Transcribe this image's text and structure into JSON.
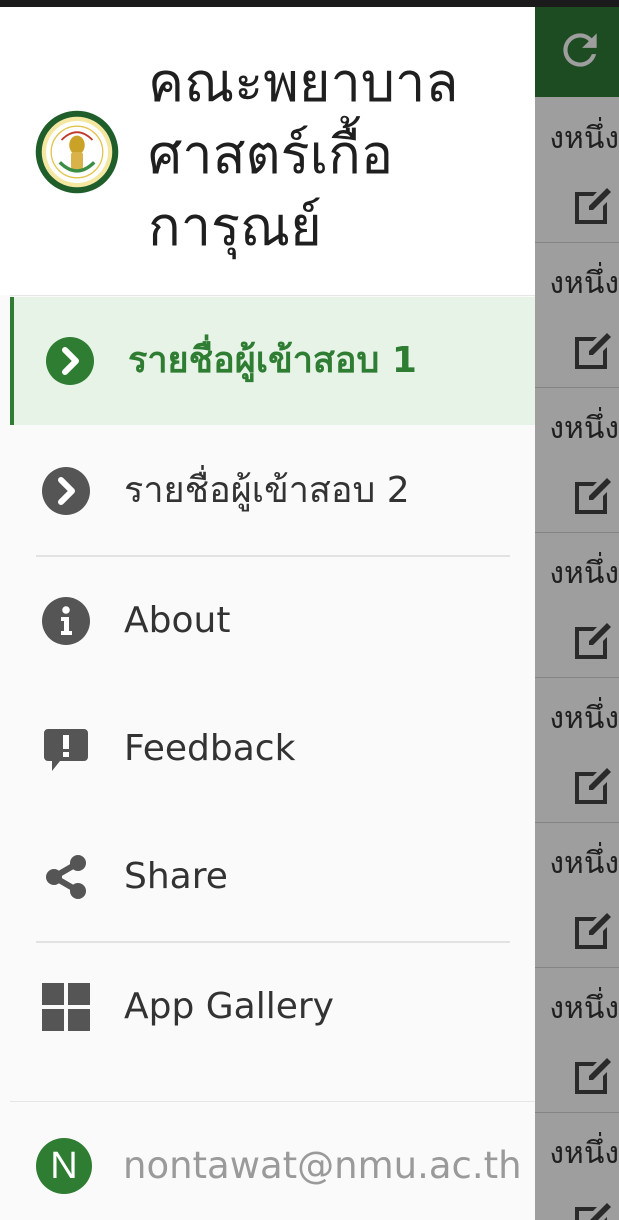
{
  "colors": {
    "accent": "#2e7d32",
    "appbar": "#2f7a37",
    "active_bg": "#e6f3e6",
    "icon_gray": "#555555"
  },
  "background_list": {
    "row_text": "งหนึ่ง",
    "row_count": 8,
    "refresh_icon": "refresh-icon",
    "edit_icon": "edit-icon"
  },
  "drawer": {
    "title": "คณะพยาบาลศาสตร์เกื้อการุณย์",
    "title_lines": [
      "คณะพยาบาล",
      "ศาสตร์เกื้อ",
      "การุณย์"
    ],
    "logo_icon": "faculty-seal-logo",
    "menu": [
      {
        "label": "รายชื่อผู้เข้าสอบ 1",
        "icon": "chevron-right-circle-icon",
        "active": true
      },
      {
        "label": "รายชื่อผู้เข้าสอบ 2",
        "icon": "chevron-right-circle-icon",
        "active": false
      },
      {
        "label": "About",
        "icon": "info-icon",
        "active": false
      },
      {
        "label": "Feedback",
        "icon": "feedback-icon",
        "active": false
      },
      {
        "label": "Share",
        "icon": "share-icon",
        "active": false
      },
      {
        "label": "App Gallery",
        "icon": "grid-icon",
        "active": false
      }
    ],
    "account": {
      "avatar_letter": "N",
      "email": "nontawat@nmu.ac.th"
    }
  }
}
